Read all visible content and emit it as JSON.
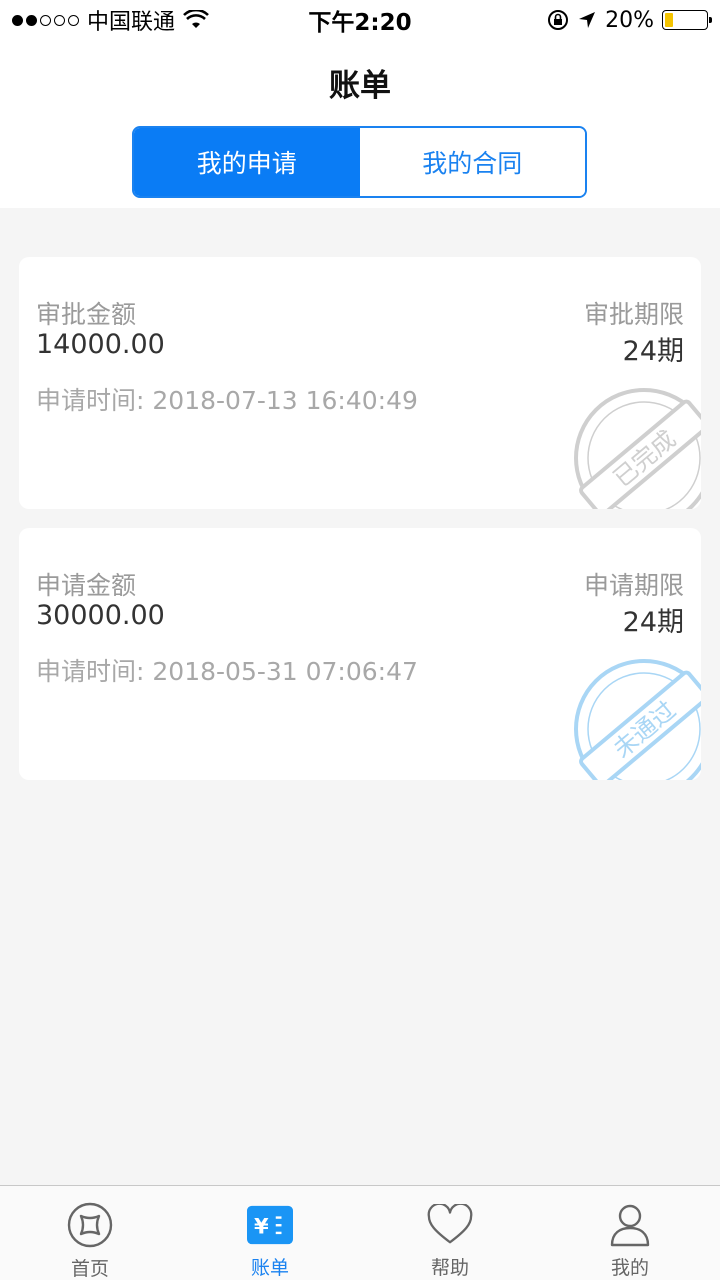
{
  "status_bar": {
    "carrier": "中国联通",
    "time": "下午2:20",
    "battery": "20%",
    "battery_level": 0.2
  },
  "header": {
    "title": "账单",
    "tabs": [
      {
        "label": "我的申请",
        "active": true
      },
      {
        "label": "我的合同",
        "active": false
      }
    ]
  },
  "cards": [
    {
      "amount_label": "审批金额",
      "amount": "14000.00",
      "term_label": "审批期限",
      "term": "24期",
      "time_label": "申请时间:",
      "time": "2018-07-13 16:40:49",
      "stamp": "已完成",
      "stamp_color": "#cfcfcf"
    },
    {
      "amount_label": "申请金额",
      "amount": "30000.00",
      "term_label": "申请期限",
      "term": "24期",
      "time_label": "申请时间:",
      "time": "2018-05-31 07:06:47",
      "stamp": "未通过",
      "stamp_color": "#a9d6f5"
    }
  ],
  "tabbar": {
    "items": [
      {
        "label": "首页",
        "icon": "home-icon",
        "active": false
      },
      {
        "label": "账单",
        "icon": "bill-icon",
        "active": true
      },
      {
        "label": "帮助",
        "icon": "heart-icon",
        "active": false
      },
      {
        "label": "我的",
        "icon": "user-icon",
        "active": false
      }
    ]
  },
  "colors": {
    "accent": "#0a7cf5",
    "background": "#f5f5f5"
  }
}
